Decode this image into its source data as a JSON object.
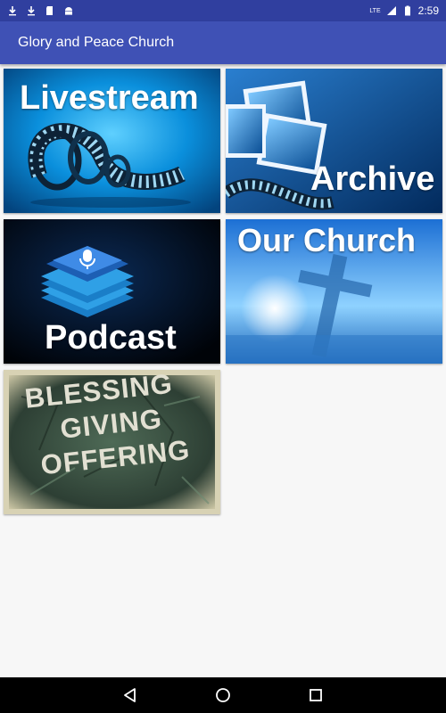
{
  "status_bar": {
    "time": "2:59",
    "network": "LTE",
    "icons": [
      "download-icon",
      "download-icon",
      "sd-card-icon",
      "android-icon",
      "signal-icon",
      "battery-icon"
    ]
  },
  "app_bar": {
    "title": "Glory and Peace Church"
  },
  "tiles": {
    "livestream": {
      "label": "Livestream"
    },
    "archive": {
      "label": "Archive"
    },
    "podcast": {
      "label": "Podcast"
    },
    "our_church": {
      "label": "Our Church"
    },
    "giving": {
      "lines": [
        "BLESSING",
        "GIVING",
        "OFFERING"
      ]
    }
  },
  "nav_bar": {
    "icons": [
      "back-icon",
      "home-icon",
      "recents-icon"
    ]
  },
  "colors": {
    "status_bar": "#303f9f",
    "app_bar": "#3f51b5",
    "background": "#f7f7f7"
  }
}
